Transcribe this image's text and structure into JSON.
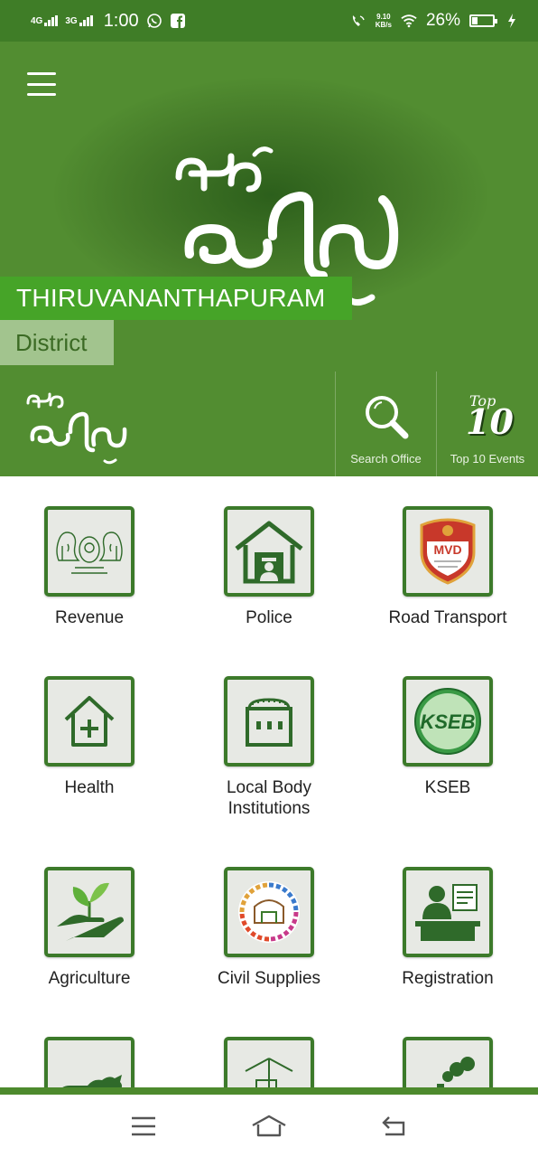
{
  "status": {
    "net1": "4G",
    "net2": "3G",
    "time": "1:00",
    "speed_value": "9.10",
    "speed_unit": "KB/s",
    "battery": "26%"
  },
  "header": {
    "district_name": "THIRUVANANTHAPURAM",
    "district_label": "District",
    "search_label": "Search Office",
    "top_label": "Top 10 Events",
    "top_badge_small": "Top",
    "top_badge_big": "10"
  },
  "tiles": [
    {
      "label": "Revenue",
      "icon": "state-emblem-icon"
    },
    {
      "label": "Police",
      "icon": "police-station-icon"
    },
    {
      "label": "Road Transport",
      "icon": "mvd-badge-icon"
    },
    {
      "label": "Health",
      "icon": "health-house-icon"
    },
    {
      "label": "Local Body\nInstitutions",
      "icon": "building-icon"
    },
    {
      "label": "KSEB",
      "icon": "kseb-logo-icon"
    },
    {
      "label": "Agriculture",
      "icon": "plant-hand-icon"
    },
    {
      "label": "Civil Supplies",
      "icon": "civil-supplies-logo-icon"
    },
    {
      "label": "Registration",
      "icon": "registration-desk-icon"
    },
    {
      "label": "",
      "icon": "cattle-icon"
    },
    {
      "label": "",
      "icon": "ship-icon"
    },
    {
      "label": "",
      "icon": "factory-pollution-icon"
    }
  ],
  "kseb_text": "KSEB",
  "mvd_text": "MVD",
  "colors": {
    "primary": "#528d31",
    "status_bar": "#3f7d27",
    "district_highlight": "#46a428",
    "tile_border": "#3c7a2a"
  }
}
